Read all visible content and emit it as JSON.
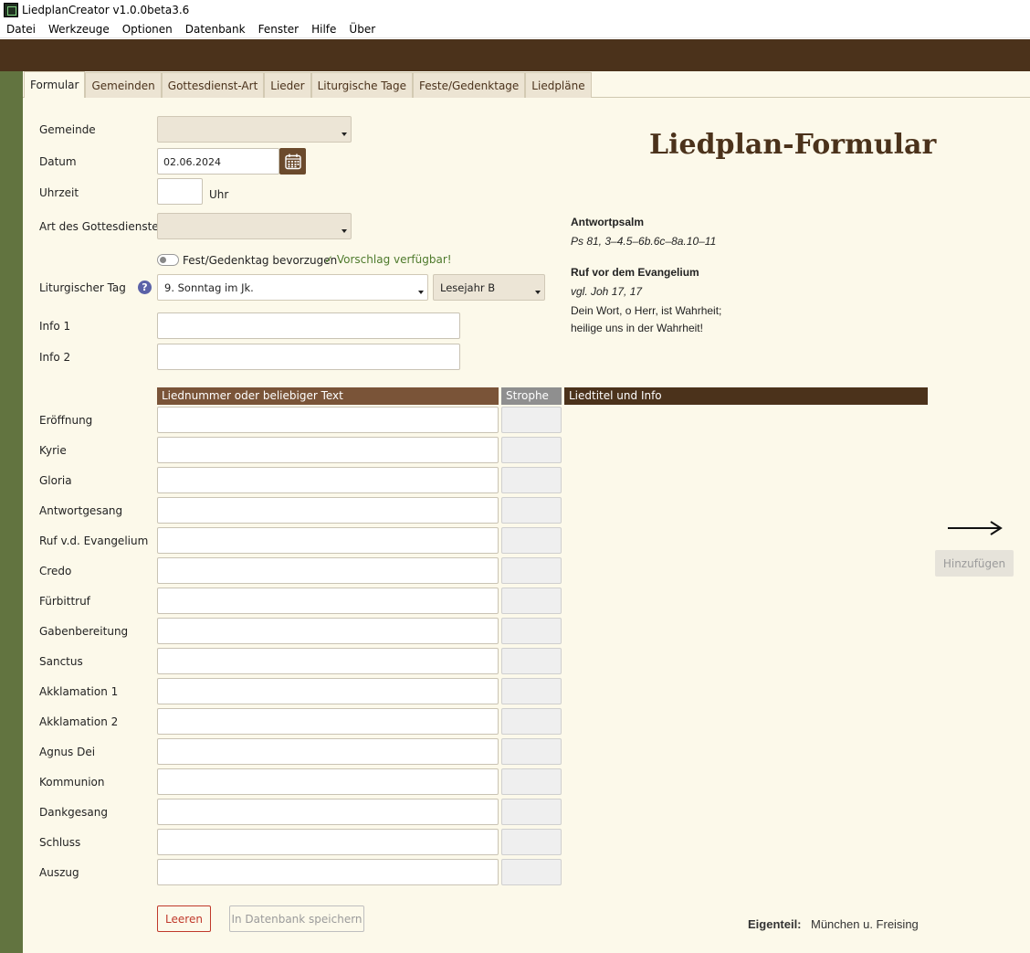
{
  "window": {
    "title": "LiedplanCreator v1.0.0beta3.6"
  },
  "menu": [
    "Datei",
    "Werkzeuge",
    "Optionen",
    "Datenbank",
    "Fenster",
    "Hilfe",
    "Über"
  ],
  "tabs": [
    {
      "label": "Formular",
      "active": true
    },
    {
      "label": "Gemeinden"
    },
    {
      "label": "Gottesdienst-Art"
    },
    {
      "label": "Lieder"
    },
    {
      "label": "Liturgische Tage"
    },
    {
      "label": "Feste/Gedenktage"
    },
    {
      "label": "Liedpläne"
    }
  ],
  "form": {
    "gemeinde_label": "Gemeinde",
    "gemeinde_value": "",
    "datum_label": "Datum",
    "datum_value": "02.06.2024",
    "uhrzeit_label": "Uhrzeit",
    "uhrzeit_value": "",
    "uhr_unit": "Uhr",
    "art_label": "Art des Gottesdienstes",
    "art_value": "",
    "fest_toggle_label": "Fest/Gedenktag bevorzugen",
    "fest_toggle_on": false,
    "vorschlag": "✓ Vorschlag verfügbar!",
    "liturgischer_tag_label": "Liturgischer Tag",
    "liturgischer_tag_value": "9. Sonntag im Jk.",
    "lesejahr_value": "Lesejahr B",
    "info1_label": "Info 1",
    "info2_label": "Info 2"
  },
  "heading": "Liedplan-Formular",
  "readings": {
    "antwortpsalm_title": "Antwortpsalm",
    "antwortpsalm_ref": "Ps 81, 3–4.5–6b.6c–8a.10–11",
    "ruf_title": "Ruf vor dem Evangelium",
    "ruf_ref": "vgl. Joh 17, 17",
    "ruf_line1": "Dein Wort, o Herr, ist Wahrheit;",
    "ruf_line2": "heilige uns in der Wahrheit!"
  },
  "table": {
    "col1": "Liednummer oder beliebiger Text",
    "col2": "Strophe",
    "col3": "Liedtitel und Info",
    "rows": [
      "Eröffnung",
      "Kyrie",
      "Gloria",
      "Antwortgesang",
      "Ruf v.d. Evangelium",
      "Credo",
      "Fürbittruf",
      "Gabenbereitung",
      "Sanctus",
      "Akklamation 1",
      "Akklamation 2",
      "Agnus Dei",
      "Kommunion",
      "Dankgesang",
      "Schluss",
      "Auszug"
    ]
  },
  "buttons": {
    "leeren": "Leeren",
    "save": "In Datenbank speichern",
    "add": "Hinzufügen"
  },
  "footer": {
    "eigenteil_label": "Eigenteil:",
    "eigenteil_value": "München u. Freising"
  },
  "colors": {
    "brown": "#4b321b",
    "green_sidebar": "#627440",
    "background": "#fcf9ea",
    "col1_head": "#7a5438",
    "col2_head": "#8f8f8f",
    "col3_head": "#4b321b"
  }
}
